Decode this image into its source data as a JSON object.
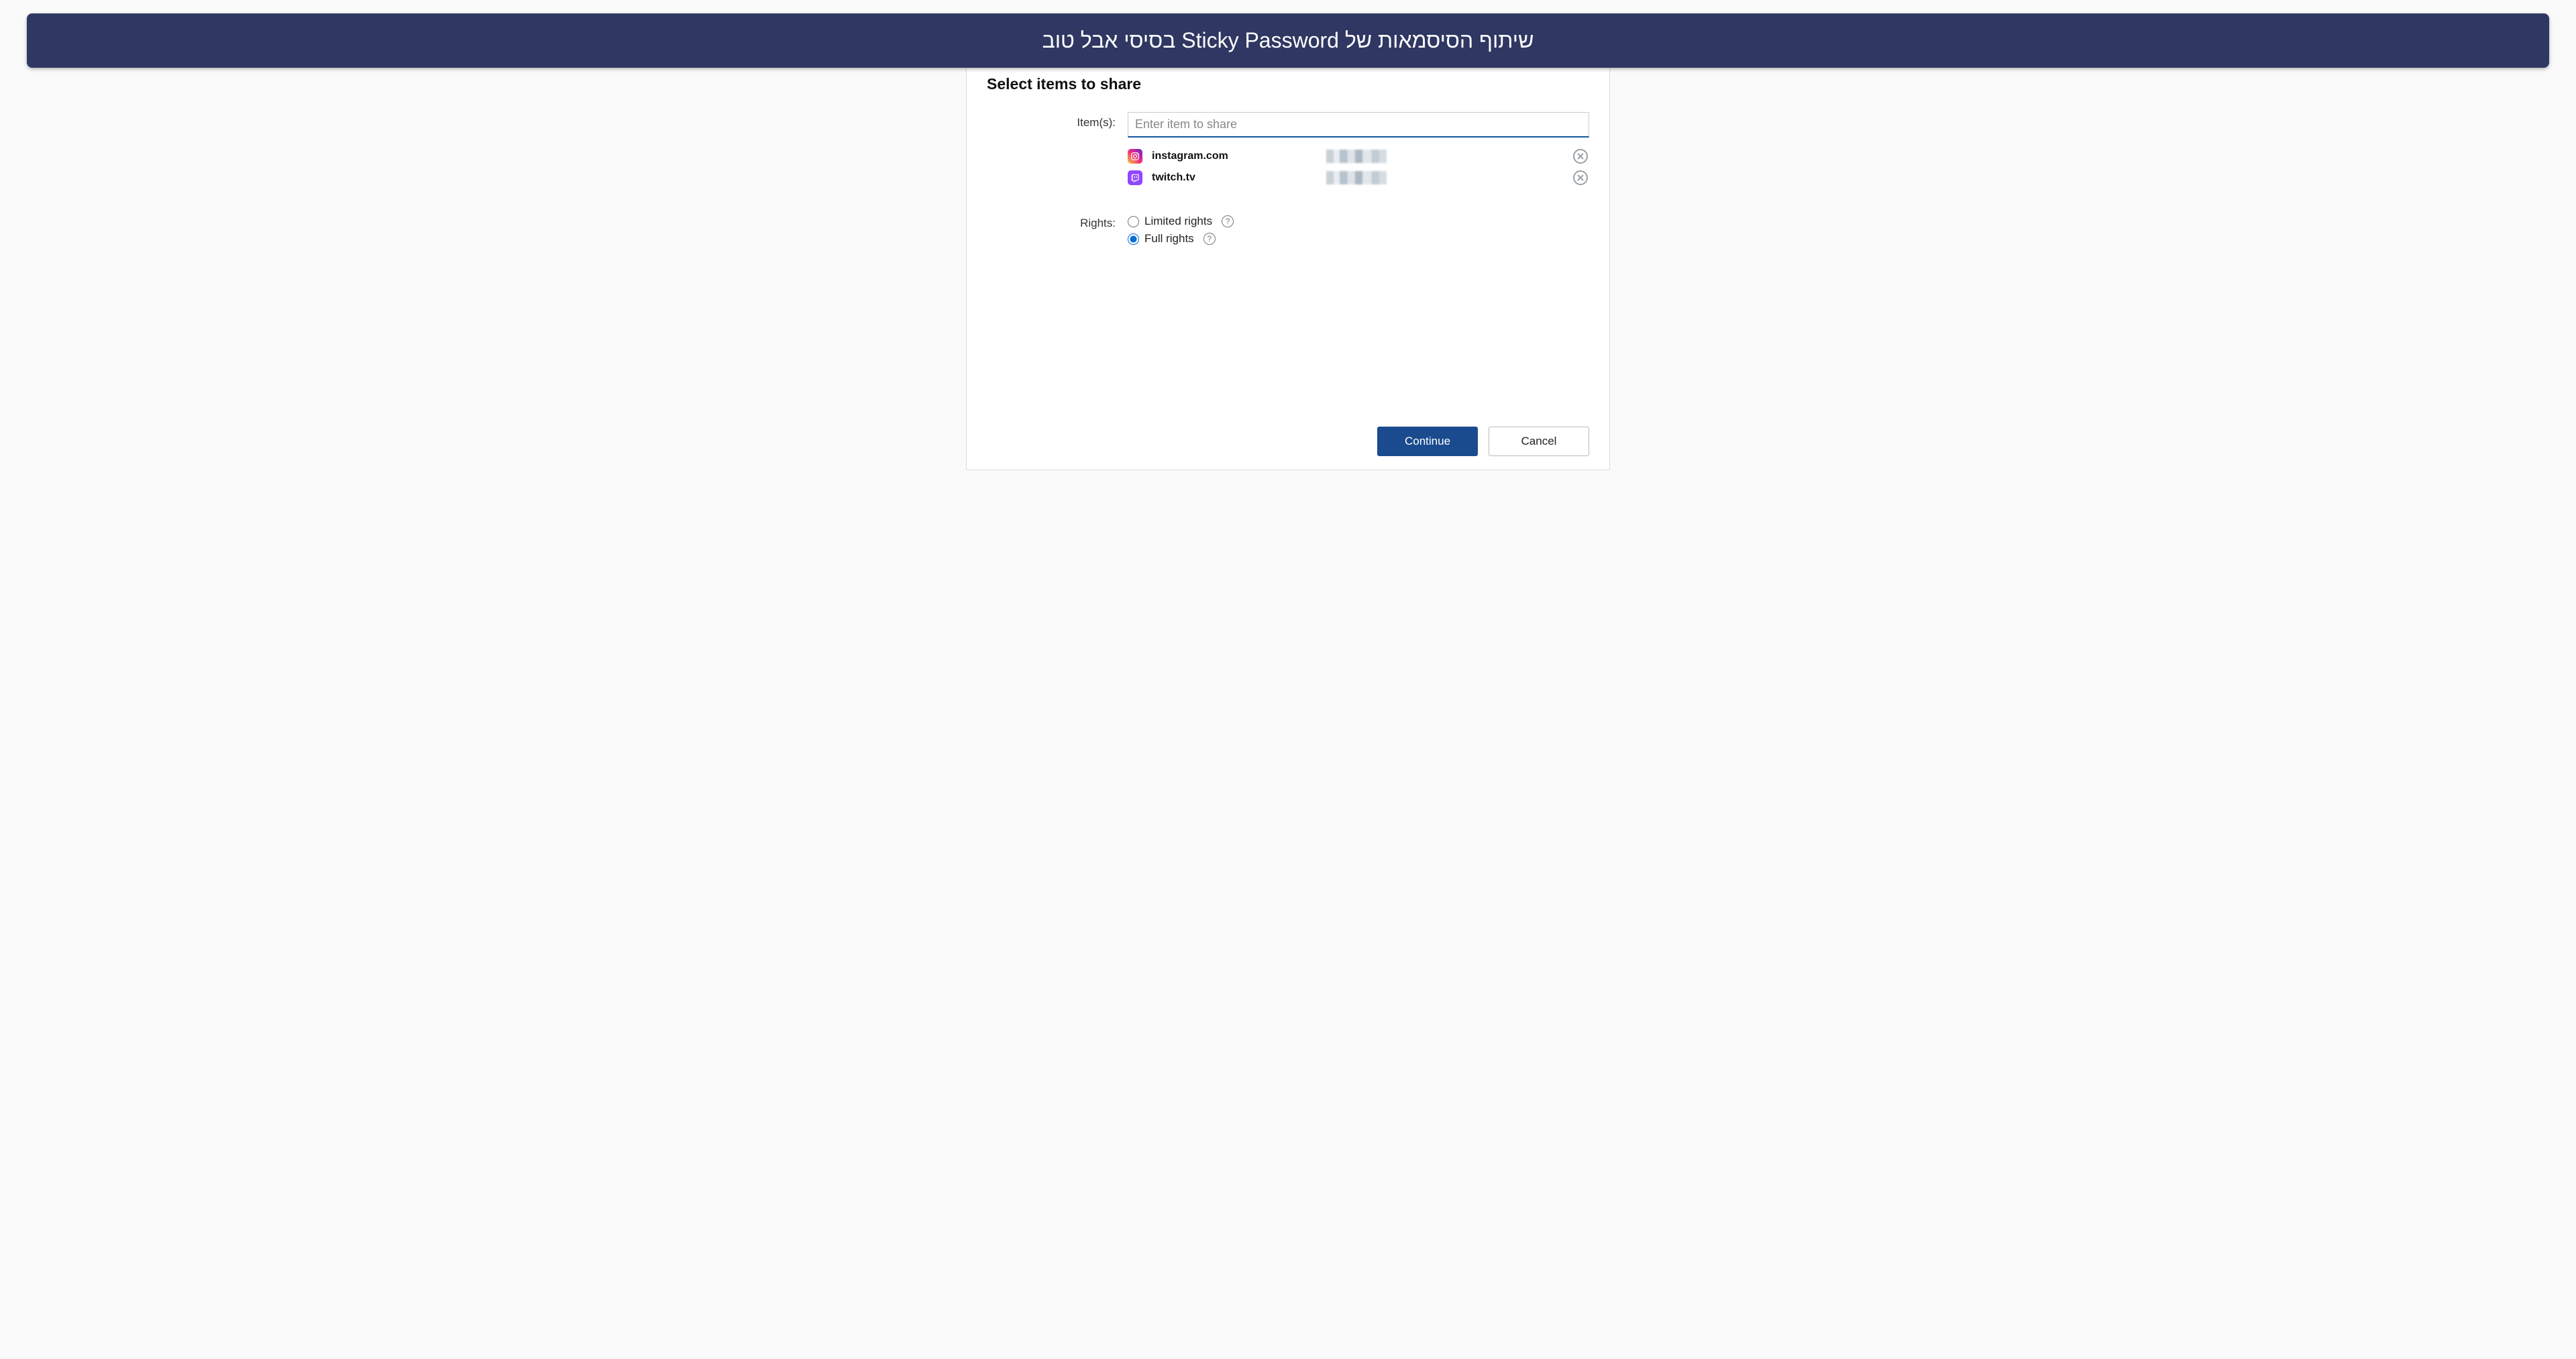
{
  "banner": {
    "text": "שיתוף הסיסמאות של Sticky Password בסיסי אבל טוב"
  },
  "dialog": {
    "heading": "Select items to share",
    "items_label": "Item(s):",
    "input_placeholder": "Enter item to share",
    "items": [
      {
        "name": "instagram.com",
        "icon": "instagram"
      },
      {
        "name": "twitch.tv",
        "icon": "twitch"
      }
    ],
    "rights_label": "Rights:",
    "rights_options": {
      "limited": "Limited rights",
      "full": "Full rights"
    },
    "buttons": {
      "continue": "Continue",
      "cancel": "Cancel"
    }
  }
}
